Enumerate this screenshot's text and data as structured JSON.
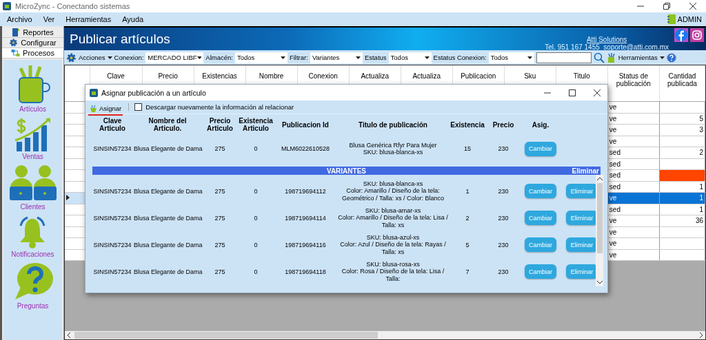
{
  "window": {
    "title": "MicroZync - Conectando sistemas"
  },
  "menu": [
    "Archivo",
    "Ver",
    "Herramientas",
    "Ayuda"
  ],
  "user": "ADMIN",
  "sidebar": {
    "tabs": [
      {
        "label": "Reportes",
        "kind": "report",
        "selected": false
      },
      {
        "label": "Configurar",
        "kind": "gear",
        "selected": false
      },
      {
        "label": "Procesos",
        "kind": "process",
        "selected": true
      }
    ],
    "modules": [
      {
        "label": "Artículos",
        "kind": "articles"
      },
      {
        "label": "Ventas",
        "kind": "sales"
      },
      {
        "label": "Clientes",
        "kind": "clients"
      },
      {
        "label": "Notificaciones",
        "kind": "bell"
      },
      {
        "label": "Preguntas",
        "kind": "question"
      }
    ]
  },
  "page": {
    "title": "Publicar artículos",
    "company_link": "Atti Solutions",
    "contact": "Tel. 951 167 1455  soporte@atti.com.mx"
  },
  "toolbar": {
    "actions": "Acciones",
    "filters": [
      {
        "label": "Conexion:",
        "value": "MERCADO LIBF"
      },
      {
        "label": "Almacén:",
        "value": "Todos"
      },
      {
        "label": "Filtrar:",
        "value": "Variantes"
      },
      {
        "label": "Estatus",
        "value": "Todos"
      },
      {
        "label": "Estatus Conexion:",
        "value": "Todos"
      }
    ],
    "tools": "Herramientas"
  },
  "grid": {
    "columns": [
      "Clave",
      "Precio",
      "Existencias",
      "Nombre",
      "Conexion",
      "Actualiza",
      "Actualiza",
      "Publicacion",
      "Sku",
      "Titulo",
      "Status de\npublicación",
      "Cantidad\npublicada"
    ],
    "rows": [
      {
        "status": "ve",
        "quantity": "",
        "selected": false,
        "flagged": false
      },
      {
        "status": "ve",
        "quantity": "5",
        "selected": false,
        "flagged": false
      },
      {
        "status": "ve",
        "quantity": "3",
        "selected": false,
        "flagged": false
      },
      {
        "status": "ve",
        "quantity": "",
        "selected": false,
        "flagged": false
      },
      {
        "status": "sed",
        "quantity": "2",
        "selected": false,
        "flagged": false
      },
      {
        "status": "sed",
        "quantity": "",
        "selected": false,
        "flagged": false
      },
      {
        "status": "sed",
        "quantity": "",
        "selected": false,
        "flagged": true
      },
      {
        "status": "sed",
        "quantity": "1",
        "selected": false,
        "flagged": false
      },
      {
        "status": "ve",
        "quantity": "1",
        "selected": true,
        "flagged": false
      },
      {
        "status": "sed",
        "quantity": "1",
        "selected": false,
        "flagged": false
      },
      {
        "status": "ve",
        "quantity": "36",
        "selected": false,
        "flagged": false
      },
      {
        "status": "ve",
        "quantity": "",
        "selected": false,
        "flagged": false
      },
      {
        "status": "ve",
        "quantity": "",
        "selected": false,
        "flagged": false
      },
      {
        "status": "ve",
        "quantity": "",
        "selected": false,
        "flagged": false
      }
    ]
  },
  "dialog": {
    "title": "Asignar publicación a un artículo",
    "assign": "Asignar",
    "redownload": {
      "label": "Descargar nuevamente la información al relacionar",
      "checked": false
    },
    "columns": [
      "Clave\nArticulo",
      "Nombre del\nArticulo.",
      "Precio\nArticulo",
      "Existencia\nArticulo",
      "Publicacion Id",
      "Titulo de publicación",
      "Existencia",
      "Precio",
      "Asig."
    ],
    "main": {
      "clave": "SINSIN57234",
      "nombre": "Blusa Elegante de Dama",
      "precio": "275",
      "existencia": "0",
      "publicacion_id": "MLM6022610528",
      "titulo": "Blusa Genérica Rfyr Para Mujer\nSKU: blusa-blanca-xs",
      "existencia_pub": "15",
      "precio_pub": "230",
      "change": "Cambiar"
    },
    "variants_bar": {
      "title": "VARIANTES",
      "action": "Eliminar"
    },
    "variants": [
      {
        "clave": "SINSIN57234",
        "nombre": "Blusa Elegante de Dama",
        "precio": "275",
        "existencia": "0",
        "publicacion_id": "198719694112",
        "titulo": "SKU: blusa-blanca-xs\nColor: Amarillo / Diseño de la tela:\nGeométrico / Talla: xs / Color: Blanco",
        "existencia_pub": "1",
        "precio_pub": "230",
        "change": "Cambiar",
        "remove": "Eliminar"
      },
      {
        "clave": "SINSIN57234",
        "nombre": "Blusa Elegante de Dama",
        "precio": "275",
        "existencia": "0",
        "publicacion_id": "198719694114",
        "titulo": "SKU: blusa-amar-xs\nColor: Amarillo / Diseño de la tela: Lisa /\nTalla: xs",
        "existencia_pub": "2",
        "precio_pub": "230",
        "change": "Cambiar",
        "remove": "Eliminar"
      },
      {
        "clave": "SINSIN57234",
        "nombre": "Blusa Elegante de Dama",
        "precio": "275",
        "existencia": "0",
        "publicacion_id": "198719694116",
        "titulo": "SKU: blusa-azul-xs\nColor: Azul / Diseño de la tela: Rayas /\nTalla: xs",
        "existencia_pub": "5",
        "precio_pub": "230",
        "change": "Cambiar",
        "remove": "Eliminar"
      },
      {
        "clave": "SINSIN57234",
        "nombre": "Blusa Elegante de Dama",
        "precio": "275",
        "existencia": "0",
        "publicacion_id": "198719694118",
        "titulo": "SKU: blusa-rosa-xs\nColor: Rosa / Diseño de la tela: Lisa / Talla:",
        "existencia_pub": "7",
        "precio_pub": "230",
        "change": "Cambiar",
        "remove": "Eliminar"
      }
    ]
  }
}
